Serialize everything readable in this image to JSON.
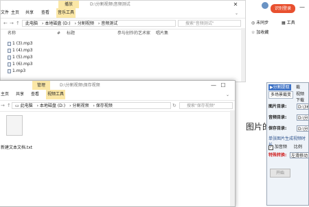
{
  "top_window": {
    "title_path": "D:\\分割视频\\音频测试",
    "ribbon_tab": "播放",
    "menu": [
      "文件",
      "主页",
      "共享",
      "查看",
      "音乐工具"
    ],
    "address": [
      "此电脑",
      "本地磁盘 (D:)",
      "分割视频",
      "音频测试"
    ],
    "search_placeholder": "搜索\"音频测试\"",
    "columns": [
      "名称",
      "#",
      "标题",
      "参与创作的艺术家",
      "唱片集"
    ],
    "files": [
      "1 (3).mp3",
      "1 (4).mp3",
      "1 (5).mp3",
      "1 (6).mp3",
      "1.mp3"
    ]
  },
  "bottom_window": {
    "title_path": "D:\\分割视频\\保存视频",
    "ribbon_tab": "管理",
    "menu": [
      "主页",
      "共享",
      "查看",
      "视频工具"
    ],
    "address": [
      "此电脑",
      "本地磁盘 (D:)",
      "分割视频",
      "保存视频"
    ],
    "search_placeholder": "搜索\"保存视频\"",
    "file_name": "新建文本文档.txt"
  },
  "browser": {
    "user_button": "识别登录",
    "actions": [
      "未同步",
      "加收藏",
      "工具"
    ]
  },
  "background_text": "图片的",
  "panel": {
    "tabs": [
      "分割提取",
      "裁"
    ],
    "subtabs": [
      "多场景裁变",
      "视频下载"
    ],
    "fields": [
      {
        "label": "图片目录:",
        "value": "D:\\360"
      },
      {
        "label": "音频目录:",
        "value": "D:\\分割"
      },
      {
        "label": "保存目录:",
        "value": "D:\\分割"
      }
    ],
    "note": "单张图片生成视频时长",
    "checkbox_label": "加音频",
    "ratio_label": "比例",
    "special_label": "特殊转换:",
    "special_value": "左滑移动",
    "start_button": "开始",
    "colors": {
      "special": "#d02020",
      "tab_blue": "#3f73c6"
    }
  }
}
